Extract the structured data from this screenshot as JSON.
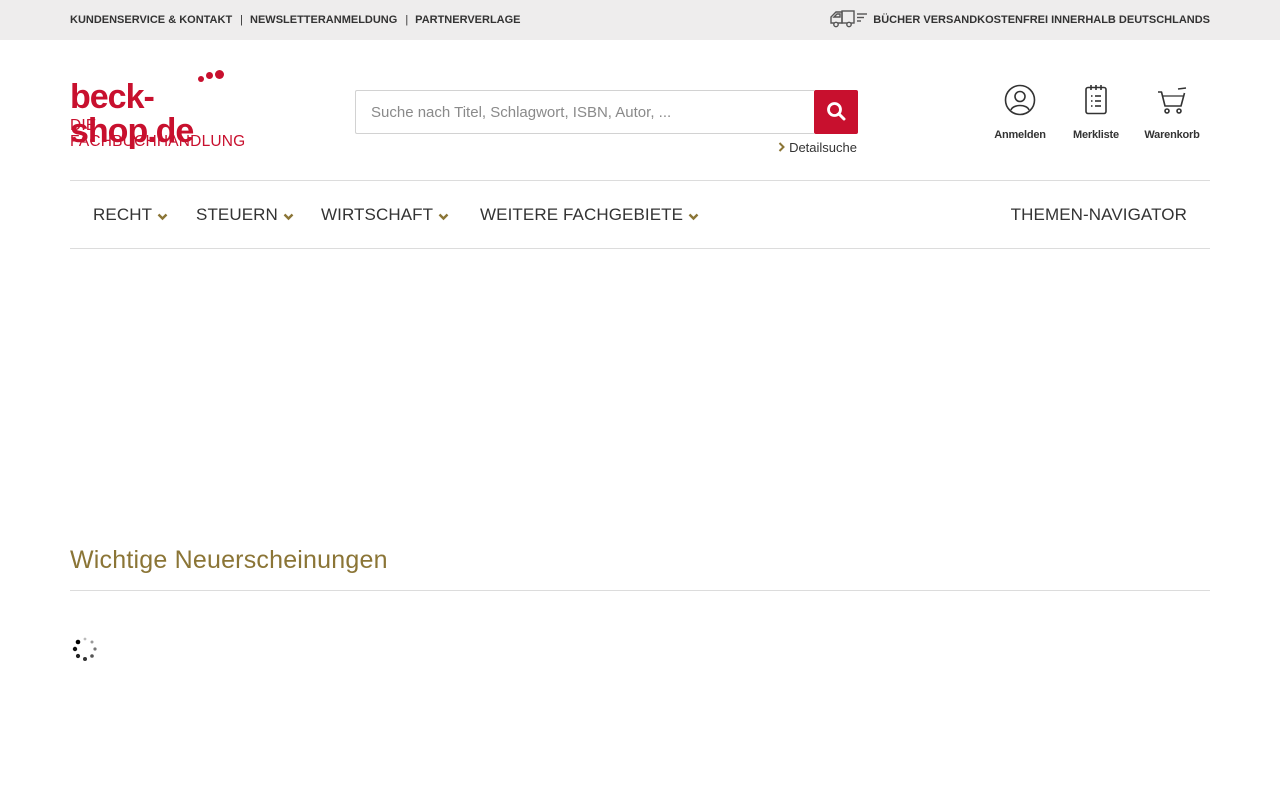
{
  "topbar": {
    "links": [
      "KUNDENSERVICE & KONTAKT",
      "NEWSLETTERANMELDUNG",
      "PARTNERVERLAGE"
    ],
    "separator": "|",
    "shipping_text": "BÜCHER VERSANDKOSTENFREI INNERHALB DEUTSCHLANDS",
    "shipping_icon": "truck-icon"
  },
  "logo": {
    "main": "beck-shop.de",
    "sub": "DIE FACHBUCHHANDLUNG"
  },
  "search": {
    "placeholder": "Suche nach Titel, Schlagwort, ISBN, Autor, ...",
    "value": "",
    "button_icon": "search-icon",
    "detail_link": "Detailsuche"
  },
  "header_icons": [
    {
      "label": "Anmelden",
      "icon": "user-icon"
    },
    {
      "label": "Merkliste",
      "icon": "notepad-icon"
    },
    {
      "label": "Warenkorb",
      "icon": "cart-icon"
    }
  ],
  "nav": {
    "items": [
      "RECHT",
      "STEUERN",
      "WIRTSCHAFT",
      "WEITERE FACHGEBIETE"
    ],
    "right": "THEMEN-NAVIGATOR"
  },
  "section": {
    "title": "Wichtige Neuerscheinungen"
  },
  "colors": {
    "brand_red": "#c8102e",
    "accent_gold": "#8b7536",
    "topbar_bg": "#eeeded"
  }
}
